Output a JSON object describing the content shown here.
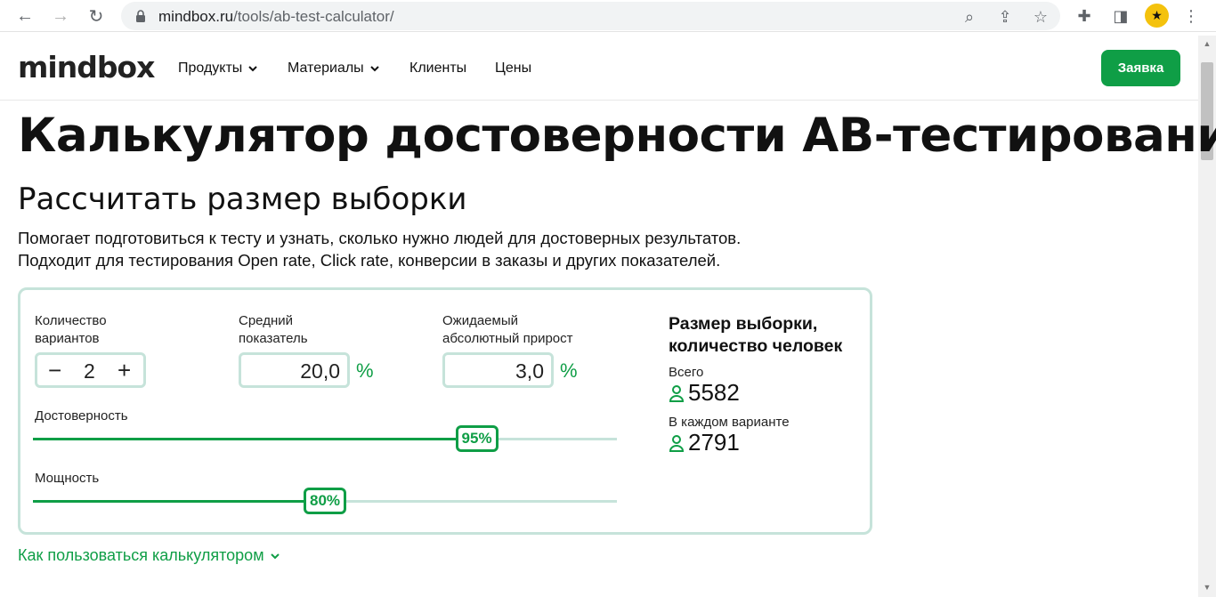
{
  "browser": {
    "url_host": "mindbox.ru",
    "url_path": "/tools/ab-test-calculator/"
  },
  "site": {
    "logo": "mindbox",
    "menu": [
      "Продукты",
      "Материалы",
      "Клиенты",
      "Цены"
    ],
    "cta": "Заявка"
  },
  "page": {
    "title": "Калькулятор достоверности AB-тестирования",
    "subtitle": "Рассчитать размер выборки",
    "lead_line1": "Помогает подготовиться к тесту и узнать, сколько нужно людей для достоверных результатов.",
    "lead_line2": "Подходит для тестирования Open rate, Click rate, конверсии в заказы и других показателей."
  },
  "calculator": {
    "variants_label_1": "Количество",
    "variants_label_2": "вариантов",
    "variants_value": "2",
    "avg_label_1": "Средний",
    "avg_label_2": "показатель",
    "avg_value": "20,0",
    "avg_unit": "%",
    "growth_label_1": "Ожидаемый",
    "growth_label_2": "абсолютный прирост",
    "growth_value": "3,0",
    "growth_unit": "%",
    "confidence_label": "Достоверность",
    "confidence_value": "95%",
    "confidence_fraction": 0.76,
    "power_label": "Мощность",
    "power_value": "80%",
    "power_fraction": 0.5
  },
  "result": {
    "title_1": "Размер выборки,",
    "title_2": "количество человек",
    "total_label": "Всего",
    "total_value": "5582",
    "per_variant_label": "В каждом варианте",
    "per_variant_value": "2791"
  },
  "howto": "Как пользоваться калькулятором",
  "colors": {
    "accent": "#0f9e46",
    "border": "#c6e3da"
  }
}
